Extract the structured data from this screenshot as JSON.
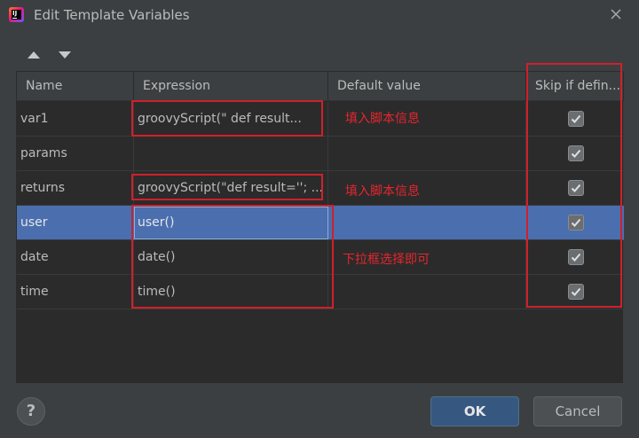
{
  "window": {
    "title": "Edit Template Variables",
    "app_icon_text": "IJ"
  },
  "toolbar": {
    "move_up_icon": "triangle-up-icon",
    "move_down_icon": "triangle-down-icon"
  },
  "table": {
    "columns": [
      "Name",
      "Expression",
      "Default value",
      "Skip if defin..."
    ],
    "rows": [
      {
        "name": "var1",
        "expression": "groovyScript(\"     def result...",
        "default": "",
        "skip": true
      },
      {
        "name": "params",
        "expression": "",
        "default": "",
        "skip": true
      },
      {
        "name": "returns",
        "expression": "groovyScript(\"def result=''; ...",
        "default": "",
        "skip": true
      },
      {
        "name": "user",
        "expression": "user()",
        "default": "",
        "skip": true,
        "selected": true
      },
      {
        "name": "date",
        "expression": "date()",
        "default": "",
        "skip": true
      },
      {
        "name": "time",
        "expression": "time()",
        "default": "",
        "skip": true
      }
    ]
  },
  "annotations": {
    "note_var1": "填入脚本信息",
    "note_returns": "填入脚本信息",
    "note_dropdown": "下拉框选择即可",
    "color": "#e5262e"
  },
  "buttons": {
    "help": "?",
    "ok": "OK",
    "cancel": "Cancel"
  },
  "colors": {
    "background": "#3c3f41",
    "selection": "#4b6eaf",
    "ok_button": "#365880"
  }
}
